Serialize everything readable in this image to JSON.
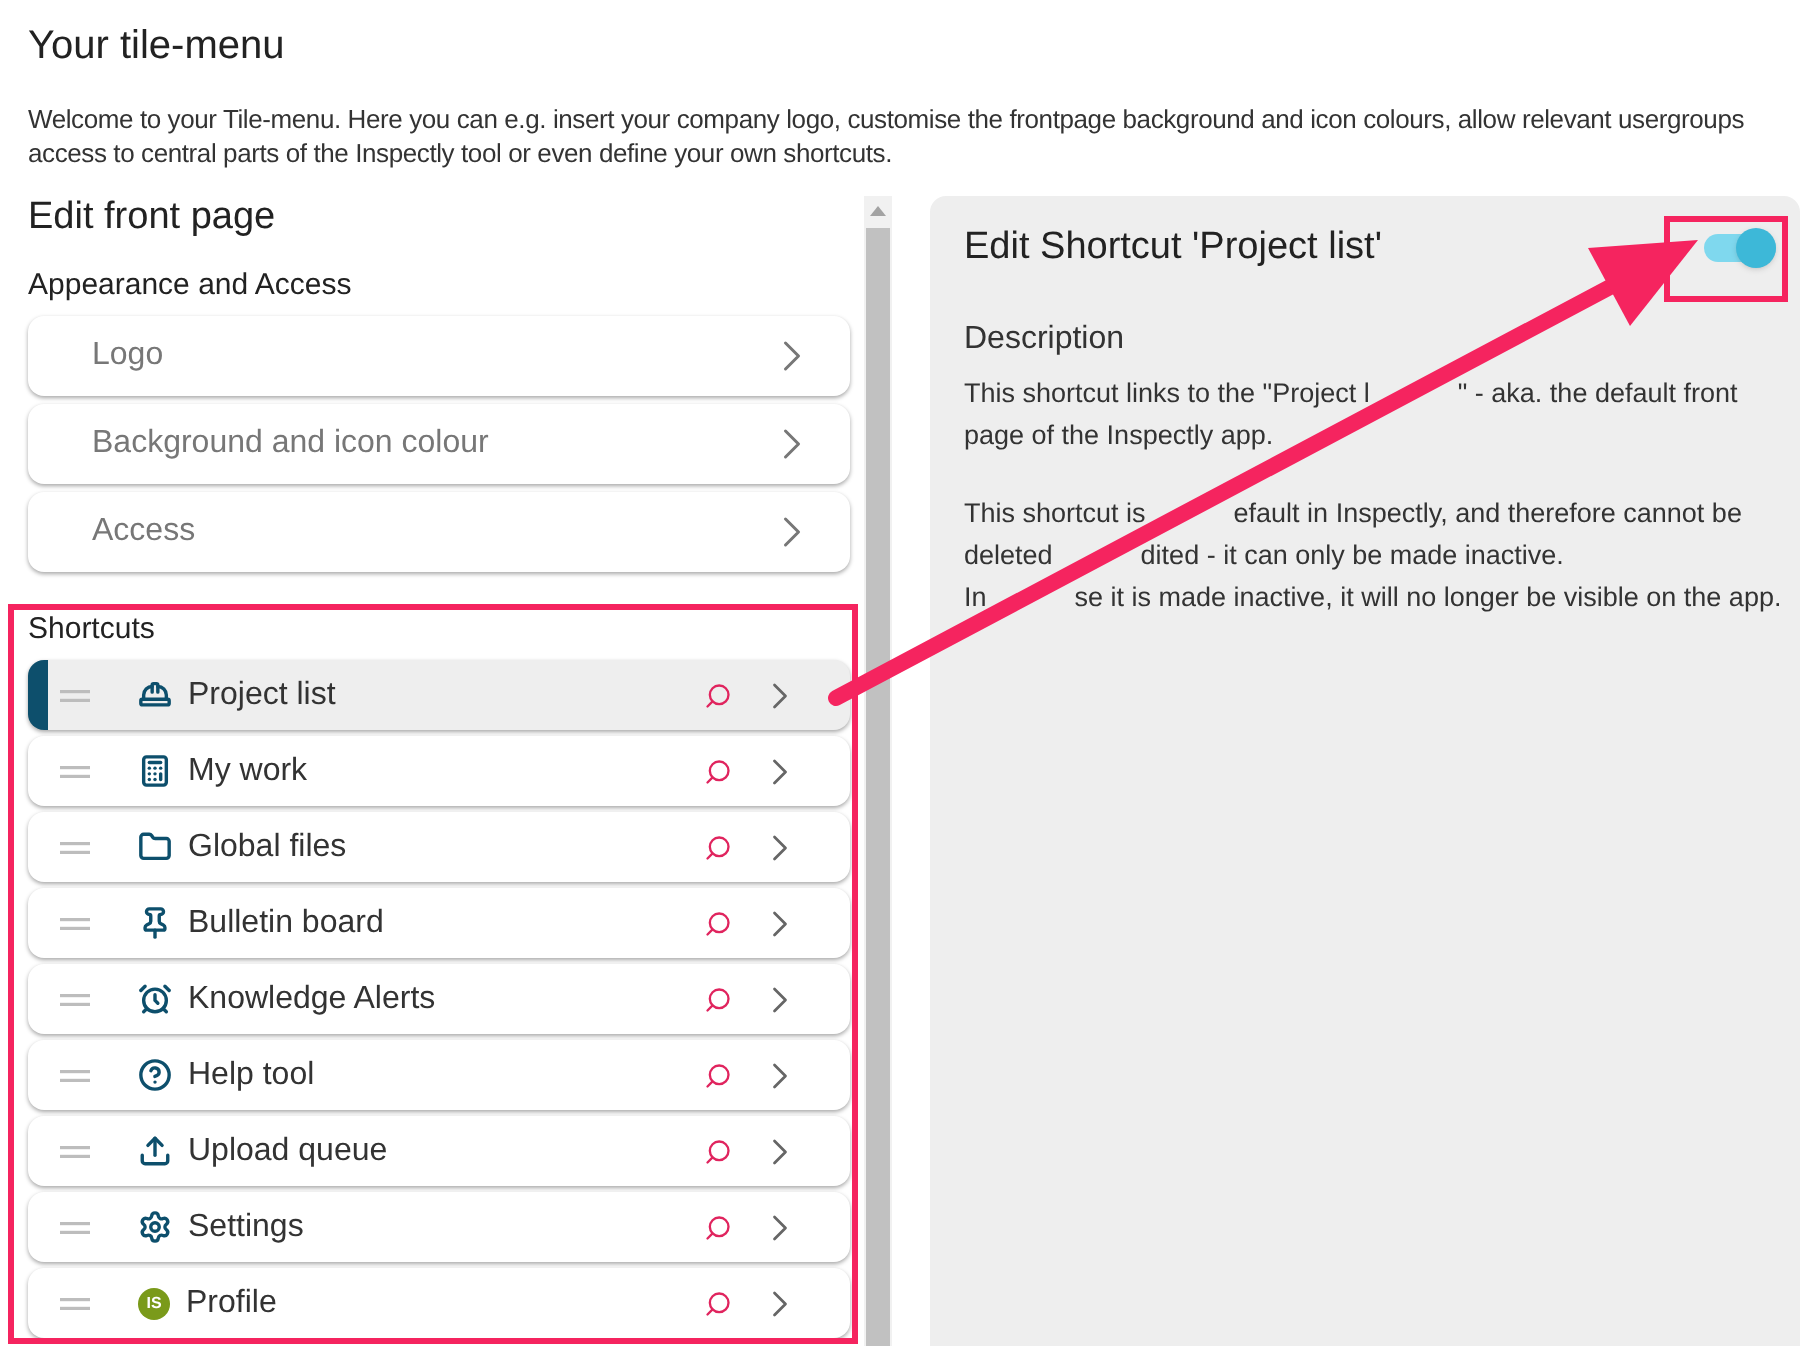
{
  "header": {
    "title": "Your tile-menu",
    "intro": "Welcome to your Tile-menu. Here you can e.g. insert your company logo, customise the frontpage background and icon colours, allow relevant usergroups access to central parts of the Inspectly tool or even define your own shortcuts."
  },
  "left": {
    "title": "Edit front page",
    "appearance_heading": "Appearance and Access",
    "appearance_items": [
      {
        "label": "Logo"
      },
      {
        "label": "Background and icon colour"
      },
      {
        "label": "Access"
      }
    ],
    "shortcuts_heading": "Shortcuts",
    "shortcuts": [
      {
        "label": "Project list",
        "selected": true
      },
      {
        "label": "My work",
        "selected": false
      },
      {
        "label": "Global files",
        "selected": false
      },
      {
        "label": "Bulletin board",
        "selected": false
      },
      {
        "label": "Knowledge Alerts",
        "selected": false
      },
      {
        "label": "Help tool",
        "selected": false
      },
      {
        "label": "Upload queue",
        "selected": false
      },
      {
        "label": "Settings",
        "selected": false
      },
      {
        "label": "Profile",
        "selected": false,
        "badge": "IS"
      }
    ]
  },
  "editor": {
    "title": "Edit Shortcut 'Project list'",
    "active": {
      "on": true
    },
    "description_heading": "Description",
    "paragraphs": [
      [
        [
          "This shortcut links to the \"Project l",
          "\" - aka. the default front"
        ],
        [
          "page of the Inspectly app."
        ]
      ],
      [
        [
          "This shortcut is",
          "efault in Inspectly, and therefore cannot be"
        ],
        [
          "deleted",
          "dited - it can only be made inactive."
        ],
        [
          "In",
          "se it is made inactive, it will no longer be visible on the app."
        ]
      ]
    ]
  }
}
